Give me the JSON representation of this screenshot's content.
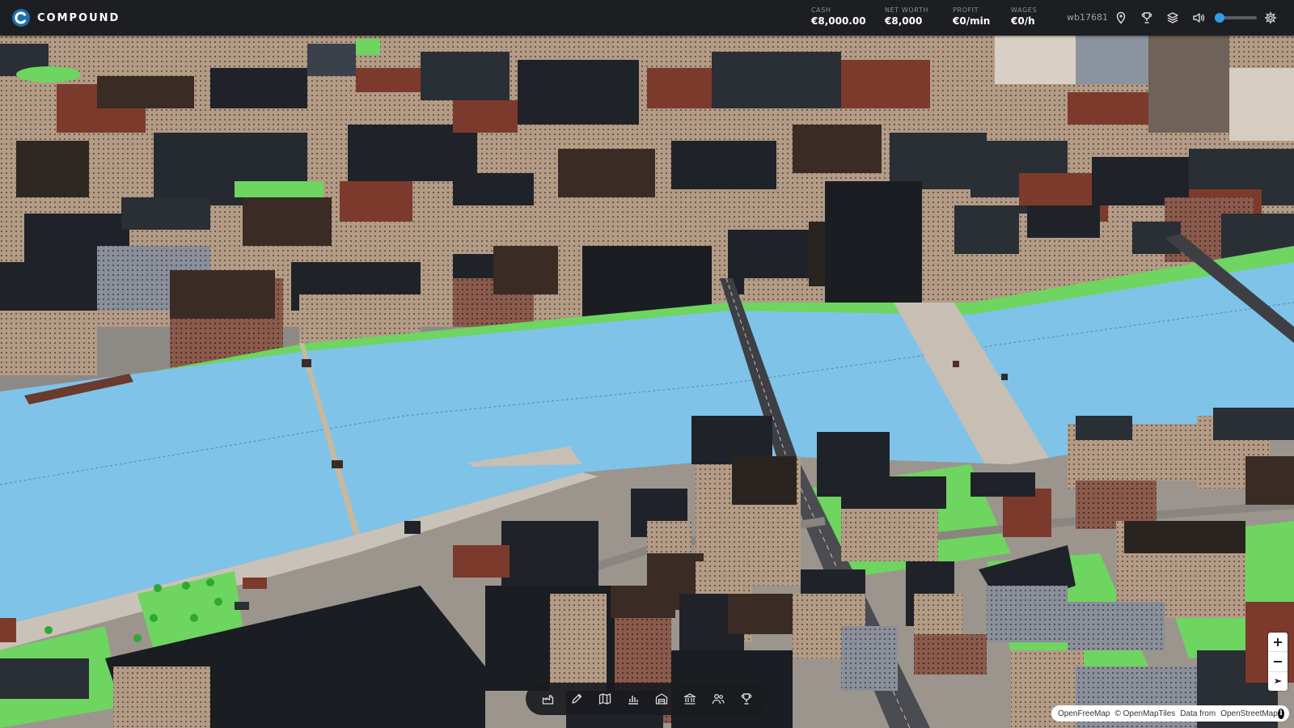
{
  "app": {
    "name": "COMPOUND"
  },
  "stats": [
    {
      "label": "CASH",
      "value": "€8,000.00"
    },
    {
      "label": "NET WORTH",
      "value": "€8,000"
    },
    {
      "label": "PROFIT",
      "value": "€0/min"
    },
    {
      "label": "WAGES",
      "value": "€0/h"
    }
  ],
  "user": {
    "name": "wb17681"
  },
  "header_icons": [
    "location-pin-icon",
    "trophy-icon",
    "layers-icon",
    "volume-icon",
    "settings-gear-icon"
  ],
  "volume": {
    "level_percent": 12
  },
  "toolbar_icons": [
    "factory-icon",
    "pencil-icon",
    "map-icon",
    "bar-chart-icon",
    "warehouse-icon",
    "bank-icon",
    "people-icon",
    "trophy-icon"
  ],
  "zoom_controls": [
    "zoom-in",
    "zoom-out",
    "reset-north"
  ],
  "attribution": {
    "part1": "OpenFreeMap",
    "part2": "© OpenMapTiles",
    "part3": "Data from",
    "part4": "OpenStreetMap"
  },
  "colors": {
    "topbar": "#1d1e22",
    "accent": "#2f9ee6",
    "water": "#7fc3e8",
    "park": "#6dd560",
    "road": "#c9c2b8",
    "building_dark": "#1f2329",
    "building_tan": "#b09a86",
    "roof_red": "#7c3a2c"
  }
}
